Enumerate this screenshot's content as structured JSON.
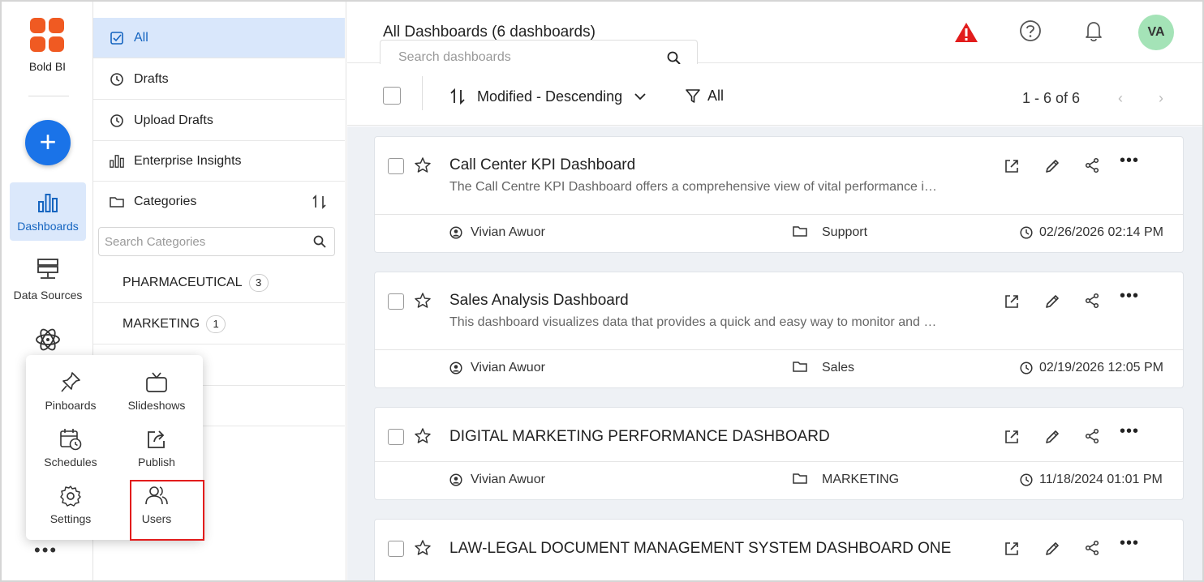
{
  "app": {
    "brand": "Bold BI"
  },
  "rail": {
    "items": [
      {
        "label": "Dashboards",
        "icon": "bar-chart-icon",
        "active": true
      },
      {
        "label": "Data Sources",
        "icon": "server-icon"
      },
      {
        "label": "",
        "icon": "atom-icon"
      }
    ],
    "more": "•••"
  },
  "sidebar": {
    "nav": [
      {
        "label": "All",
        "icon": "checkbox-icon",
        "active": true
      },
      {
        "label": "Drafts",
        "icon": "clock-icon"
      },
      {
        "label": "Upload Drafts",
        "icon": "clock-icon"
      },
      {
        "label": "Enterprise Insights",
        "icon": "bar-chart-icon"
      },
      {
        "label": "Categories",
        "icon": "folder-icon"
      }
    ],
    "category_search_placeholder": "Search Categories",
    "categories": [
      {
        "name": "PHARMACEUTICAL",
        "count": "3"
      },
      {
        "name": "MARKETING",
        "count": "1"
      }
    ]
  },
  "popup": {
    "items": [
      {
        "label": "Pinboards",
        "icon": "pin-icon"
      },
      {
        "label": "Slideshows",
        "icon": "tv-icon"
      },
      {
        "label": "Schedules",
        "icon": "calendar-clock-icon"
      },
      {
        "label": "Publish",
        "icon": "publish-icon"
      },
      {
        "label": "Settings",
        "icon": "gear-icon"
      },
      {
        "label": "Users",
        "icon": "users-icon"
      }
    ]
  },
  "header": {
    "title": "All Dashboards (6 dashboards)",
    "search_placeholder": "Search dashboards",
    "avatar_initials": "VA",
    "alert_color": "#e21c1c"
  },
  "toolbar": {
    "sort_label": "Modified - Descending",
    "filter_label": "All",
    "pager": "1 - 6 of 6"
  },
  "dashboards": [
    {
      "title": "Call Center KPI Dashboard",
      "description": "The Call Centre KPI Dashboard offers a comprehensive view of vital performance i…",
      "owner": "Vivian Awuor",
      "category": "Support",
      "modified": "02/26/2026 02:14 PM"
    },
    {
      "title": "Sales Analysis Dashboard",
      "description": "This dashboard visualizes data that provides a quick and easy way to monitor and …",
      "owner": "Vivian Awuor",
      "category": "Sales",
      "modified": "02/19/2026 12:05 PM"
    },
    {
      "title": "DIGITAL MARKETING PERFORMANCE DASHBOARD",
      "description": "",
      "owner": "Vivian Awuor",
      "category": "MARKETING",
      "modified": "11/18/2024 01:01 PM"
    },
    {
      "title": "LAW-LEGAL DOCUMENT MANAGEMENT SYSTEM DASHBOARD ONE",
      "description": "",
      "owner": "",
      "category": "",
      "modified": ""
    }
  ],
  "colors": {
    "accent": "#1a73e8",
    "active_bg": "#d9e7fb",
    "logo": "#f05a22",
    "highlight_box": "#e21c1c"
  }
}
